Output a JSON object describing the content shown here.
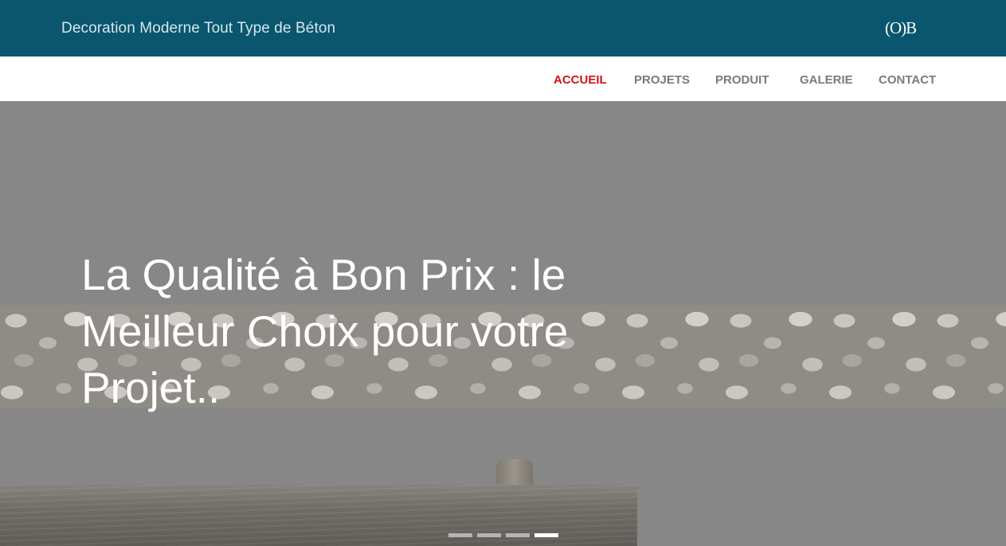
{
  "header": {
    "tagline": "Decoration Moderne Tout Type de Béton",
    "logo": "(O)B"
  },
  "nav": {
    "items": [
      {
        "label": "ACCUEIL",
        "active": true
      },
      {
        "label": "PROJETS",
        "active": false
      },
      {
        "label": "PRODUIT",
        "active": false
      },
      {
        "label": "GALERIE",
        "active": false
      },
      {
        "label": "CONTACT",
        "active": false
      }
    ]
  },
  "hero": {
    "headline": "La Qualité à Bon Prix : le Meilleur Choix pour votre Projet..",
    "slides_total": 4,
    "active_slide": 4
  },
  "colors": {
    "header_bg": "#0a566f",
    "active_nav": "#d0121b",
    "nav_text": "#7a7a7a"
  }
}
